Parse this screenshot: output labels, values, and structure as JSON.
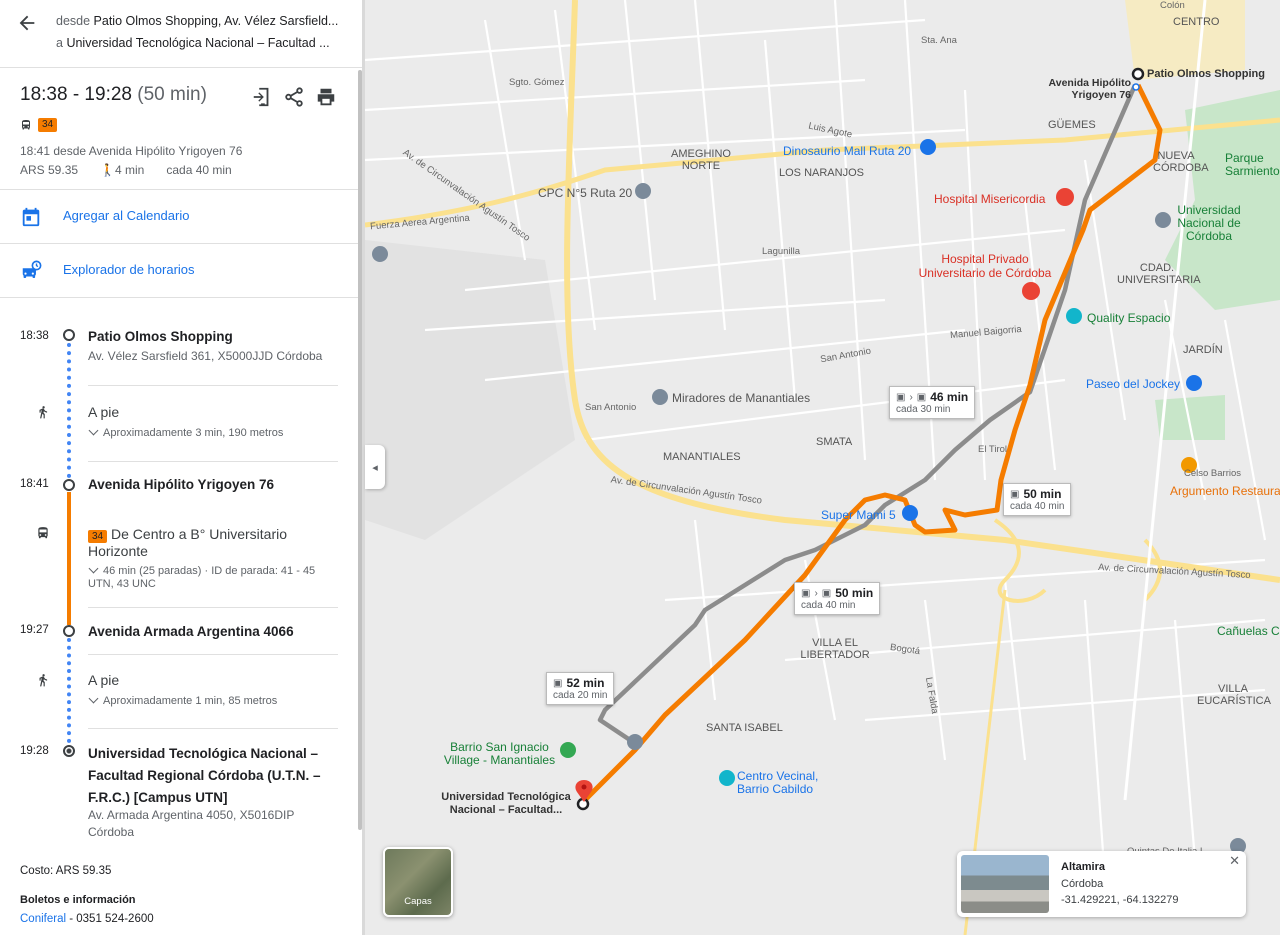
{
  "header": {
    "from_prefix": "desde ",
    "from": "Patio Olmos Shopping, Av. Vélez Sarsfield...",
    "to_prefix": "a ",
    "to": "Universidad Tecnológica Nacional – Facultad ..."
  },
  "summary": {
    "times": "18:38 - 19:28",
    "duration": "(50 min)",
    "bus_number": "34",
    "departure": "18:41 desde Avenida Hipólito Yrigoyen 76",
    "fare": "ARS 59.35",
    "walk": "4 min",
    "frequency": "cada 40 min"
  },
  "links": {
    "calendar": "Agregar al Calendario",
    "schedules": "Explorador de horarios"
  },
  "steps": {
    "s1_time": "18:38",
    "s1_name": "Patio Olmos Shopping",
    "s1_addr": "Av. Vélez Sarsfield 361, X5000JJD Córdoba",
    "walk1_title": "A pie",
    "walk1_sub": "Aproximadamente 3 min, 190 metros",
    "s2_time": "18:41",
    "s2_name": "Avenida Hipólito Yrigoyen 76",
    "bus_badge": "34",
    "bus_title": "De Centro a B° Universitario Horizonte",
    "bus_sub": "46 min (25 paradas) · ID de parada: 41 - 45 UTN, 43 UNC",
    "s3_time": "19:27",
    "s3_name": "Avenida Armada Argentina 4066",
    "walk2_title": "A pie",
    "walk2_sub": "Aproximadamente 1 min, 85 metros",
    "s4_time": "19:28",
    "s4_name": "Universidad Tecnológica Nacional – Facultad Regional Córdoba (U.T.N. – F.R.C.) [Campus UTN]",
    "s4_addr": "Av. Armada Argentina 4050, X5016DIP Córdoba"
  },
  "footer": {
    "cost": "Costo: ARS 59.35",
    "tickets_title": "Boletos e información",
    "operator": "Coniferal",
    "phone": " - 0351 524-2600"
  },
  "map": {
    "labels": {
      "centro": "CENTRO",
      "colon": "Colón",
      "sta_ana": "Sta. Ana",
      "guemes": "GÜEMES",
      "nueva_cordoba": "NUEVA CÓRDOBA",
      "parque": "Parque Sarmiento",
      "unc": "Universidad Nacional de Córdoba",
      "cdad_univ": "CDAD. UNIVERSITARIA",
      "jardin": "JARDÍN",
      "ameghino": "AMEGHINO NORTE",
      "los_naranjos": "LOS NARANJOS",
      "dinosaurio": "Dinosaurio Mall Ruta 20",
      "cpc": "CPC N°5 Ruta 20",
      "hospital_mis": "Hospital Misericordia",
      "hospital_priv": "Hospital Privado Universitario de Córdoba",
      "quality": "Quality Espacio",
      "jockey": "Paseo del Jockey",
      "miradores": "Miradores de Manantiales",
      "smata": "SMATA",
      "manantiales": "MANANTIALES",
      "el_tirol": "El Tirol",
      "super_mami": "Super Mami 5",
      "celso": "Celso Barrios",
      "argumento": "Argumento Restaura",
      "villa_lib": "VILLA EL LIBERTADOR",
      "santa_isabel": "SANTA ISABEL",
      "villa_euc": "VILLA EUCARÍSTICA",
      "canuelas": "Cañuelas C",
      "barrio_san_ignacio": "Barrio San Ignacio Village - Manantiales",
      "centro_vecinal": "Centro Vecinal, Barrio Cabildo",
      "utn_map": "Universidad Tecnológica Nacional – Facultad...",
      "origin_map": "Patio Olmos Shopping",
      "origin_stop": "Avenida Hipólito Yrigoyen 76",
      "circ1": "Av. de Circunvalación Agustín Tosco",
      "circ2": "Av. de Circunvalación Agustín Tosco",
      "circ3": "Av. de Circunvalación Agustín Tosco",
      "fuerza": "Fuerza Aerea Argentina",
      "san_antonio1": "San Antonio",
      "san_antonio2": "San Antonio",
      "baigorria": "Manuel Baigorria",
      "sgto_gomez": "Sgto. Gómez",
      "bogota": "Bogotá",
      "la_falda": "La Falda",
      "quintas": "Quintas De Italia I",
      "luis_agote": "Luis Agote",
      "lagunilla": "Lagunilla"
    },
    "cards": [
      {
        "minutes": "46 min",
        "freq": "cada 30 min"
      },
      {
        "minutes": "50 min",
        "freq": "cada 40 min"
      },
      {
        "minutes": "50 min",
        "freq": "cada 40 min"
      },
      {
        "minutes": "52 min",
        "freq": "cada 20 min"
      }
    ],
    "layers_label": "Capas",
    "info": {
      "title": "Altamira",
      "city": "Córdoba",
      "coords": "-31.429221, -64.132279"
    }
  }
}
